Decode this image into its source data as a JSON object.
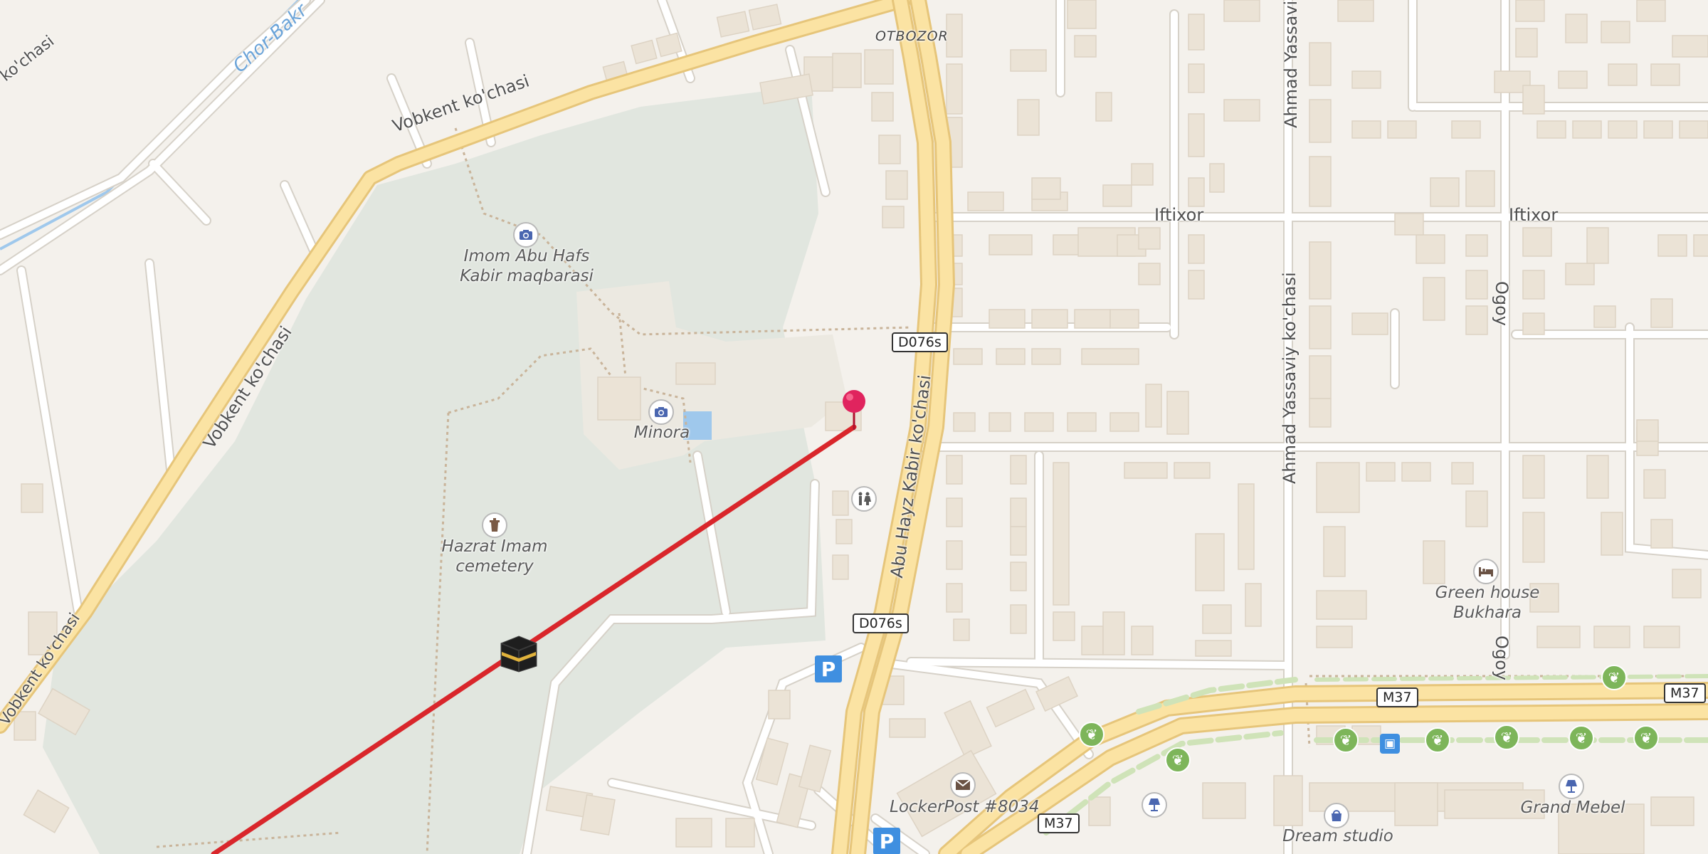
{
  "labels": {
    "vobkent_top": "Vobkent ko'chasi",
    "vobkent_left": "Vobkent ko'chasi",
    "vobkent_corner": "Vobkent ko'chasi",
    "ko_chasi_topleft": "ko'chasi",
    "chor_bakr": "Chor-Bakr",
    "otbozor": "OTBOZOR",
    "iftixor_1": "Iftixor",
    "iftixor_2": "Iftixor",
    "ahmad_top": "Ahmad Yassaviy",
    "ahmad_mid": "Ahmad Yassaviy ko'chasi",
    "abu_hayz": "Abu Hayz Kabir ko'chasi",
    "oqoy_1": "Ogoy",
    "oqoy_2": "Ogoy"
  },
  "shields": {
    "d076_1": "D076s",
    "d076_2": "D076s",
    "m37_1": "M37",
    "m37_2": "M37",
    "m37_3": "M37"
  },
  "pois": {
    "imom_line1": "Imom Abu Hafs",
    "imom_line2": "Kabir maqbarasi",
    "minora": "Minora",
    "hazrat_line1": "Hazrat Imam",
    "hazrat_line2": "cemetery",
    "green_house_line1": "Green house",
    "green_house_line2": "Bukhara",
    "lockerpost": "LockerPost #8034",
    "dream_studio": "Dream studio",
    "grand_mebel": "Grand Mebel"
  },
  "icons": {
    "parking": "P",
    "camera": "camera-icon",
    "toilet": "toilets-icon",
    "cemetery": "cemetery-icon",
    "hotel": "hotel-icon",
    "post": "mail-icon",
    "shop": "shopping-bag-icon",
    "furniture": "lamp-icon",
    "tree": "tree-icon",
    "bus": "bus-icon",
    "kaaba": "kaaba-icon",
    "pin": "location-pin-icon"
  },
  "colors": {
    "land": "#f4f1ec",
    "park": "#e1e6df",
    "major_road": "#fbe3a3",
    "major_road_edge": "#e6c57a",
    "minor_road": "#ffffff",
    "building": "#ebe3d6",
    "qibla_line": "#d9262b",
    "pin": "#e0245e",
    "water": "#9fc8ec"
  }
}
